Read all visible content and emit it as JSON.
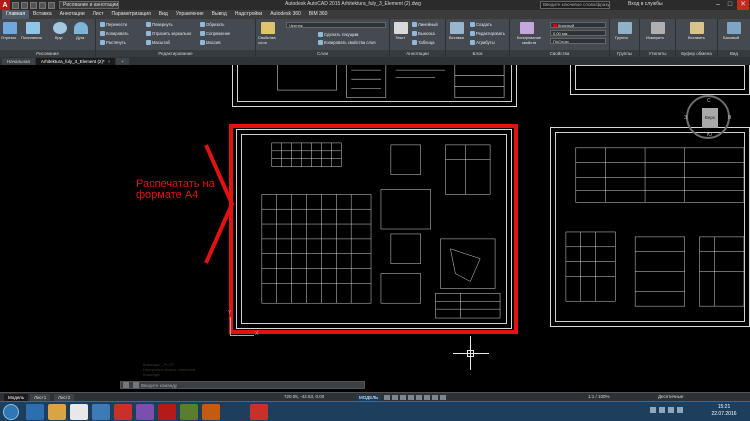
{
  "titlebar": {
    "app_icon": "A",
    "workspace": "Рисование и аннотации",
    "title": "Autodesk AutoCAD 2015   Arhitektura_fuly_3_Element (2).dwg",
    "search_placeholder": "Введите ключевое слово/фразу",
    "signin": "Вход в службы",
    "minimize": "–",
    "maximize": "□",
    "close": "✕"
  },
  "menu": {
    "tabs": [
      "Главная",
      "Вставка",
      "Аннотации",
      "Лист",
      "Параметризация",
      "Вид",
      "Управление",
      "Вывод",
      "Надстройки",
      "Autodesk 360",
      "BIM 360"
    ],
    "active_index": 0
  },
  "ribbon": {
    "draw": {
      "title": "Рисование",
      "big": [
        "Отрезок",
        "Полилиния",
        "Круг",
        "Дуга"
      ]
    },
    "modify": {
      "title": "Редактирование",
      "items": [
        "Перенести",
        "Повернуть",
        "Обрезать",
        "Копировать",
        "Отразить зеркально",
        "Сопряжение",
        "Растянуть",
        "Масштаб",
        "Массив"
      ]
    },
    "layers": {
      "title": "Слои",
      "big": "Свойства слоя",
      "layer_name": "Чертеж",
      "items": [
        "Сделать текущим",
        "Копировать свойства слоя"
      ]
    },
    "annotation": {
      "title": "Аннотации",
      "big": "Текст",
      "items": [
        "Линейный",
        "Выноска",
        "Таблица"
      ]
    },
    "block": {
      "title": "Блок",
      "big": "Вставка",
      "items": [
        "Создать",
        "Редактировать",
        "Атрибуты"
      ]
    },
    "properties": {
      "title": "Свойства",
      "big": "Копирование свойств",
      "color": "Красный",
      "lineweight": "0.00 мм",
      "linetype": "ПоСлою"
    },
    "groups": {
      "title": "Группы",
      "big": "Группа"
    },
    "utilities": {
      "title": "Утилиты",
      "big": "Измерить"
    },
    "clipboard": {
      "title": "Буфер обмена",
      "big": "Вставить"
    },
    "view": {
      "title": "Вид",
      "big": "Базовый"
    },
    "accent": "#e11212"
  },
  "doc_tabs": [
    "Начальная",
    "Arhitektura_fuly_3_Element (2)*"
  ],
  "canvas": {
    "annotation": "Распечатать на формате А4",
    "viewcube_face": "Верх",
    "compass": {
      "n": "С",
      "s": "Ю",
      "w": "З",
      "e": "В"
    },
    "ucs_x": "X",
    "ucs_y": "Y",
    "command_history": [
      "Команда: _PLOT",
      "Настройка печати отменена",
      "Команда:"
    ],
    "command_placeholder": "Введите команду"
  },
  "status": {
    "layout_tabs": [
      "Модель",
      "Лист1",
      "Лист2"
    ],
    "coords": "720.05, -42.53, 0.00",
    "model": "МОДЕЛЬ",
    "scale": "1:1 / 100%",
    "workspace": "Десятичные"
  },
  "taskbar": {
    "time": "15:21",
    "date": "22.07.2016"
  }
}
